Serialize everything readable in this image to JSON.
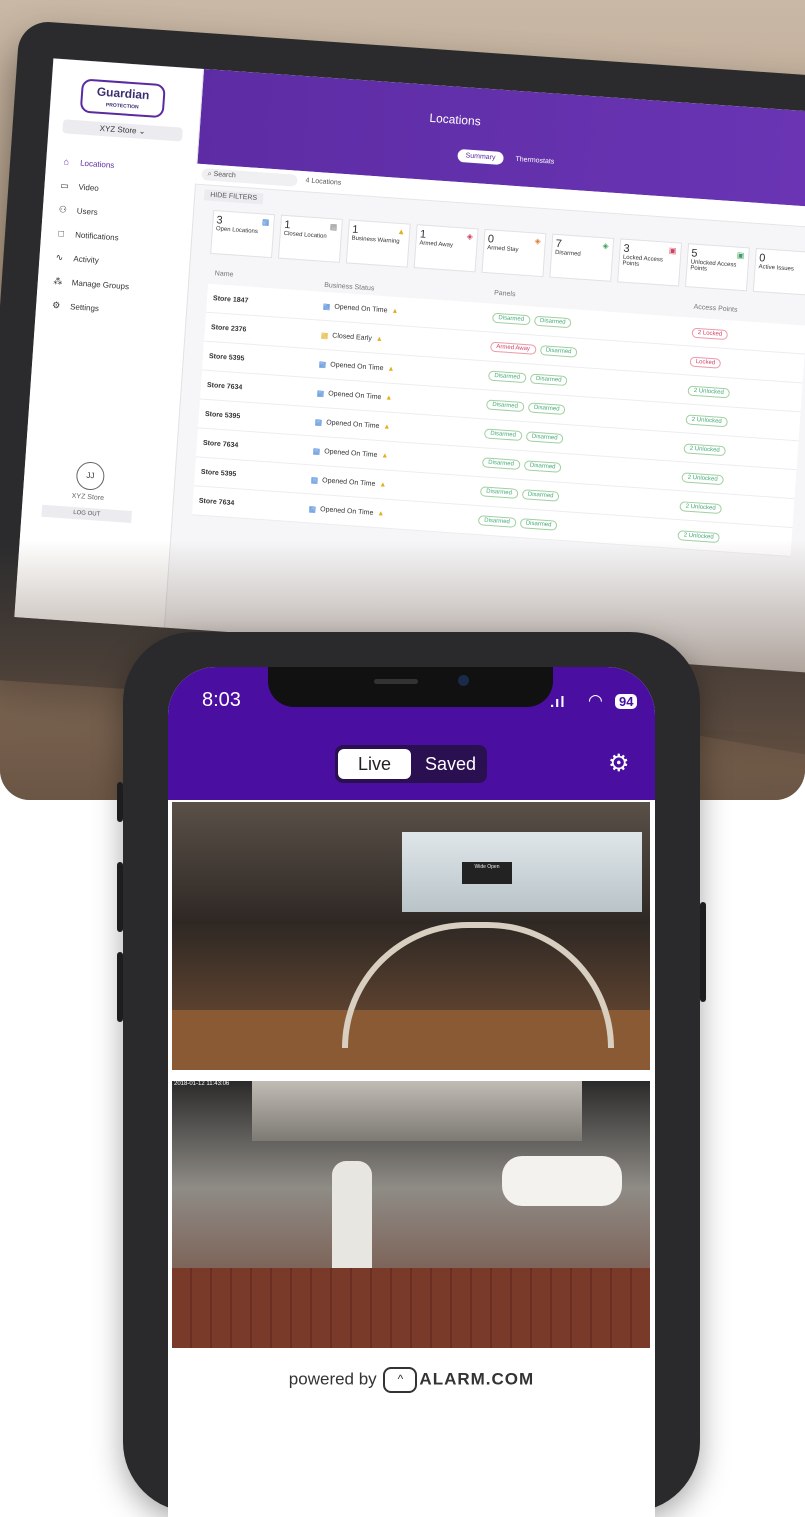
{
  "laptop_app": {
    "title": "Locations",
    "tabs": [
      "Summary",
      "Thermostats"
    ],
    "brand": "Guardian",
    "brand_sub": "PROTECTION",
    "store_selector": "XYZ Store",
    "nav": [
      {
        "label": "Locations",
        "icon": "home-icon"
      },
      {
        "label": "Video",
        "icon": "video-icon"
      },
      {
        "label": "Users",
        "icon": "users-icon"
      },
      {
        "label": "Notifications",
        "icon": "bell-icon"
      },
      {
        "label": "Activity",
        "icon": "activity-icon"
      },
      {
        "label": "Manage Groups",
        "icon": "groups-icon"
      },
      {
        "label": "Settings",
        "icon": "settings-icon"
      }
    ],
    "avatar_initials": "JJ",
    "avatar_name": "XYZ Store",
    "logout": "LOG OUT",
    "search_placeholder": "Search",
    "location_count": "4 Locations",
    "hide_filters": "HIDE FILTERS",
    "cards": [
      {
        "value": "3",
        "label": "Open Locations"
      },
      {
        "value": "1",
        "label": "Closed Location"
      },
      {
        "value": "1",
        "label": "Business Warning"
      },
      {
        "value": "1",
        "label": "Armed Away"
      },
      {
        "value": "0",
        "label": "Armed Stay"
      },
      {
        "value": "7",
        "label": "Disarmed"
      },
      {
        "value": "3",
        "label": "Locked Access Points"
      },
      {
        "value": "5",
        "label": "Unlocked Access Points"
      },
      {
        "value": "0",
        "label": "Active Issues"
      }
    ],
    "columns": [
      "Name",
      "Business Status",
      "Panels",
      "Access Points"
    ],
    "rows": [
      {
        "name": "Store 1847",
        "status": "Opened On Time",
        "panel1": "Disarmed",
        "panel2": "Disarmed",
        "access": "2 Locked"
      },
      {
        "name": "Store 2376",
        "status": "Closed Early",
        "panel1": "Armed Away",
        "panel2": "Disarmed",
        "access": "Locked"
      },
      {
        "name": "Store 5395",
        "status": "Opened On Time",
        "panel1": "Disarmed",
        "panel2": "Disarmed",
        "access": "2 Unlocked"
      },
      {
        "name": "Store 7634",
        "status": "Opened On Time",
        "panel1": "Disarmed",
        "panel2": "Disarmed",
        "access": "2 Unlocked"
      },
      {
        "name": "Store 5395",
        "status": "Opened On Time",
        "panel1": "Disarmed",
        "panel2": "Disarmed",
        "access": "2 Unlocked"
      },
      {
        "name": "Store 7634",
        "status": "Opened On Time",
        "panel1": "Disarmed",
        "panel2": "Disarmed",
        "access": "2 Unlocked"
      },
      {
        "name": "Store 5395",
        "status": "Opened On Time",
        "panel1": "Disarmed",
        "panel2": "Disarmed",
        "access": "2 Unlocked"
      },
      {
        "name": "Store 7634",
        "status": "Opened On Time",
        "panel1": "Disarmed",
        "panel2": "Disarmed",
        "access": "2 Unlocked"
      }
    ]
  },
  "phone": {
    "time": "8:03",
    "battery": "94",
    "toggle": {
      "live": "Live",
      "saved": "Saved"
    },
    "feed1_sign": "Wide Open",
    "feed2_stamp": "2018-01-12 11:43:06",
    "powered_by": "powered by",
    "alarm_brand": "ALARM.COM"
  },
  "colors": {
    "purple": "#4a0fa0",
    "app_header": "#5a2aa0"
  }
}
